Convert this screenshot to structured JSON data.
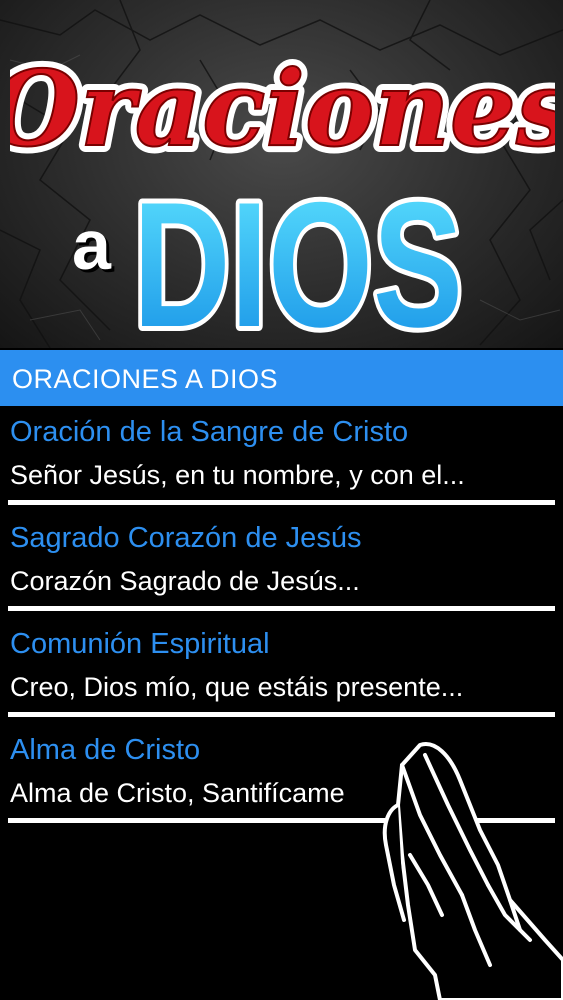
{
  "header": {
    "logo_line1": "Oraciones",
    "logo_small": "a",
    "logo_line2": "DIOS"
  },
  "section": {
    "title": "ORACIONES A DIOS"
  },
  "prayers": [
    {
      "title": "Oración de la Sangre de Cristo",
      "preview": "Señor Jesús, en tu nombre, y con el..."
    },
    {
      "title": "Sagrado Corazón de Jesús",
      "preview": "Corazón Sagrado de Jesús..."
    },
    {
      "title": "Comunión Espiritual",
      "preview": "Creo, Dios mío, que estáis presente..."
    },
    {
      "title": "Alma de Cristo",
      "preview": "Alma de Cristo, Santifícame"
    }
  ],
  "colors": {
    "accent_blue": "#2c8ff0",
    "logo_red": "#d8141c",
    "logo_cyan": "#19b6f0"
  },
  "icons": {
    "decoration": "praying-hands-icon"
  }
}
